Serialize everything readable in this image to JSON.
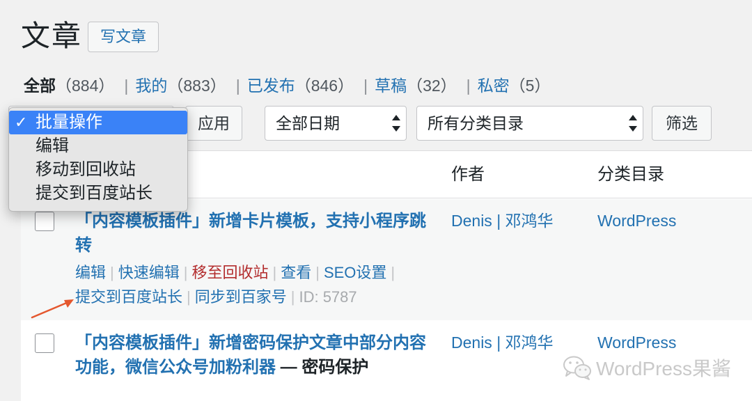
{
  "page": {
    "title": "文章",
    "add_new": "写文章"
  },
  "views": [
    {
      "label": "全部",
      "count": "（884）",
      "sep": "|"
    },
    {
      "label": "我的",
      "count": "（883）",
      "sep": "|"
    },
    {
      "label": "已发布",
      "count": "（846）",
      "sep": "|"
    },
    {
      "label": "草稿",
      "count": "（32）",
      "sep": "|"
    },
    {
      "label": "私密",
      "count": "（5）"
    }
  ],
  "toolbar": {
    "apply_label": "应用",
    "date_filter": "全部日期",
    "category_filter": "所有分类目录",
    "filter_label": "筛选"
  },
  "bulk_menu": {
    "check": "✓",
    "selected": "批量操作",
    "items": [
      "编辑",
      "移动到回收站",
      "提交到百度站长"
    ]
  },
  "table": {
    "columns": {
      "author": "作者",
      "categories": "分类目录"
    },
    "rows": [
      {
        "title": "「内容模板插件」新增卡片模板，支持小程序跳转",
        "author": "Denis | 邓鸿华",
        "category": "WordPress",
        "actions_line1": [
          "编辑",
          "快速编辑",
          "移至回收站",
          "查看",
          "SEO设置"
        ],
        "actions_line2": [
          "提交到百度站长",
          "同步到百家号"
        ],
        "separator": "|",
        "post_id": "ID: 5787"
      },
      {
        "title": "「内容模板插件」新增密码保护文章中部分内容功能，微信公众号加粉利器",
        "state": " — 密码保护",
        "author": "Denis | 邓鸿华",
        "category": "WordPress"
      }
    ]
  },
  "watermark": {
    "text": "WordPress果酱",
    "icon": "wechat-icon"
  },
  "colors": {
    "link": "#2271b1",
    "trash": "#b32d2e",
    "menu_highlight": "#3a82f7",
    "annotation_arrow": "#e4572e"
  }
}
